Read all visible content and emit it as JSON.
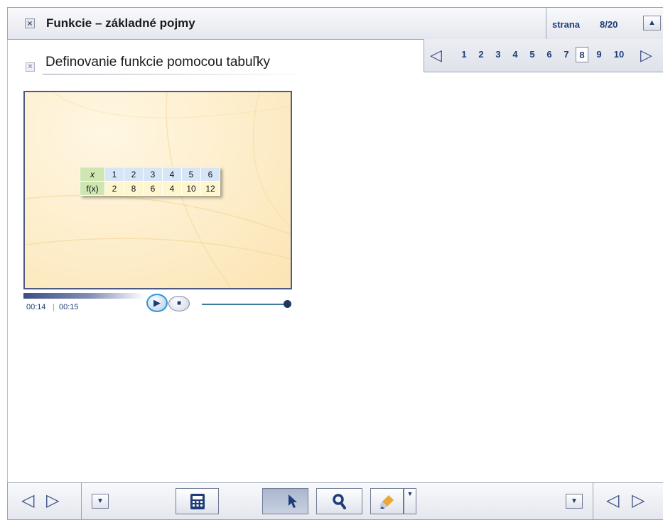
{
  "header": {
    "title": "Funkcie – základné pojmy",
    "close_icon": "close-box-icon",
    "page_label": "strana",
    "page_value": "8/20",
    "collapse_icon": "triangle-up-icon"
  },
  "pager": {
    "prev_icon": "triangle-left-icon",
    "next_icon": "triangle-right-icon",
    "pages": [
      "1",
      "2",
      "3",
      "4",
      "5",
      "6",
      "7",
      "8",
      "9",
      "10"
    ],
    "current": "8"
  },
  "section": {
    "title": "Definovanie funkcie pomocou tabuľky",
    "icon": "close-box-icon"
  },
  "video": {
    "table": {
      "x_label": "x",
      "fx_label": "f(x)",
      "x_values": [
        "1",
        "2",
        "3",
        "4",
        "5",
        "6"
      ],
      "fx_values": [
        "2",
        "8",
        "6",
        "4",
        "10",
        "12"
      ]
    },
    "time_current": "00:14",
    "time_separator": "|",
    "time_total": "00:15",
    "progress": 0.93,
    "volume": 1.0,
    "play_icon": "play-icon",
    "stop_icon": "stop-icon"
  },
  "footer": {
    "nav_prev_icon": "triangle-left-icon",
    "nav_next_icon": "triangle-right-icon",
    "menu_icon": "dropdown-icon",
    "calculator_icon": "calculator-icon",
    "pointer_icon": "cursor-icon",
    "zoom_icon": "magnifier-icon",
    "pen_icon": "highlighter-icon",
    "pen_menu_icon": "dropdown-arrow-icon",
    "right_menu_icon": "dropdown-icon",
    "right_prev_icon": "triangle-left-icon",
    "right_next_icon": "triangle-right-icon"
  },
  "colors": {
    "accent": "#1e3c78",
    "border": "#9aa3b5",
    "video_bg": "#fdecc7",
    "play_ring": "#2b9ad6"
  }
}
